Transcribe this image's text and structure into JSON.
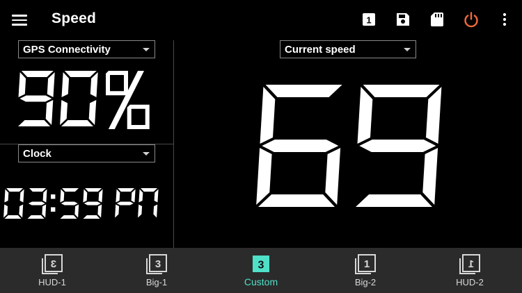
{
  "app_bar": {
    "title": "Speed",
    "menu_icon": "hamburger-menu-icon",
    "actions": [
      {
        "name": "layout-1-icon",
        "label": "1"
      },
      {
        "name": "save-icon"
      },
      {
        "name": "sd-card-icon"
      },
      {
        "name": "power-icon",
        "color": "#f26b3a"
      },
      {
        "name": "more-vert-icon"
      }
    ]
  },
  "left_top": {
    "selector": "GPS Connectivity",
    "value": "90%"
  },
  "left_bottom": {
    "selector": "Clock",
    "value": "03:59 PM"
  },
  "right": {
    "selector": "Current speed",
    "value": "69"
  },
  "bottom_nav": {
    "active_index": 2,
    "active_color": "#4fe0c8",
    "items": [
      {
        "label": "HUD-1",
        "icon_glyph": "3",
        "mirrored": true
      },
      {
        "label": "Big-1",
        "icon_glyph": "3",
        "mirrored": false
      },
      {
        "label": "Custom",
        "icon_glyph": "3",
        "mirrored": false
      },
      {
        "label": "Big-2",
        "icon_glyph": "1",
        "mirrored": false
      },
      {
        "label": "HUD-2",
        "icon_glyph": "1",
        "mirrored": true
      }
    ]
  }
}
